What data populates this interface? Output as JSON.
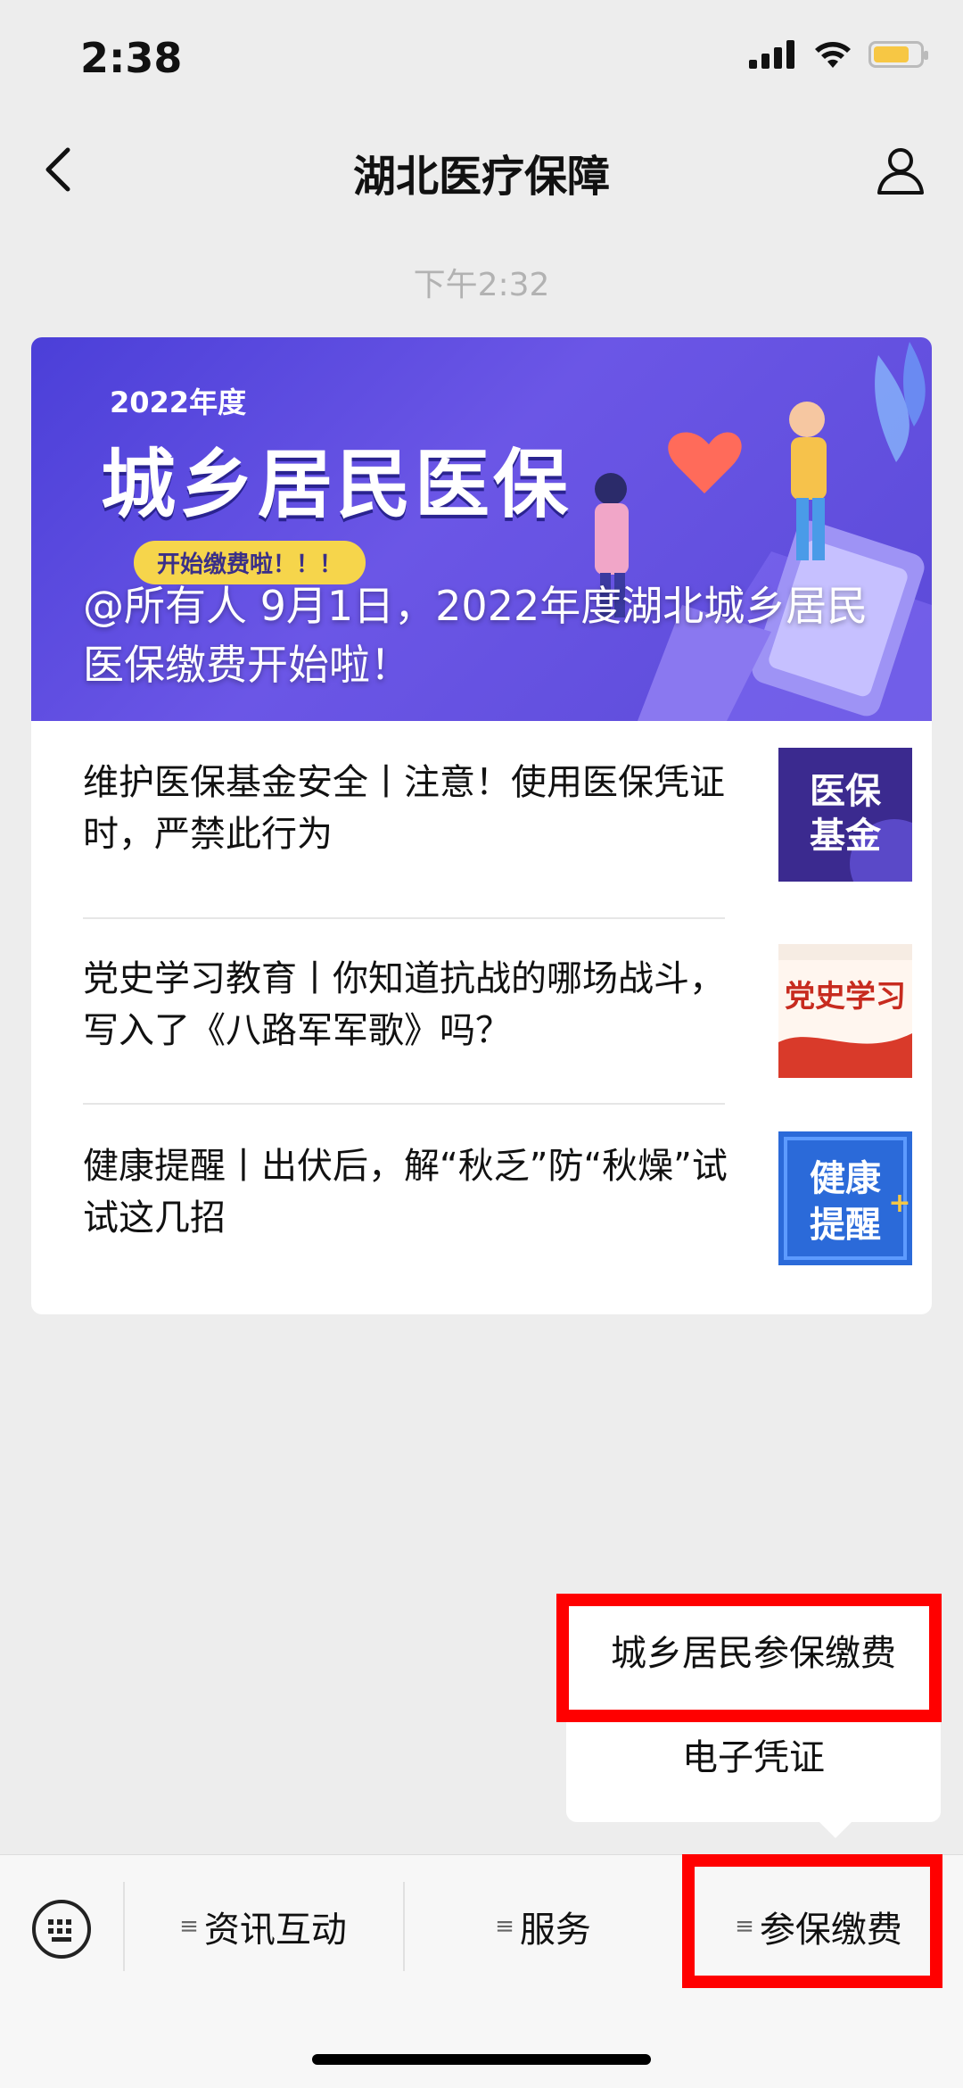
{
  "status_bar": {
    "time": "2:38"
  },
  "nav": {
    "title": "湖北医疗保障"
  },
  "message": {
    "timestamp": "下午2:32"
  },
  "banner": {
    "year_label": "2022年度",
    "main_title": "城乡居民医保",
    "sub_label": "开始缴费啦！！！",
    "overlay_title": "@所有人 9月1日，2022年度湖北城乡居民医保缴费开始啦！"
  },
  "articles": [
    {
      "title": "维护医保基金安全丨注意！使用医保凭证时，严禁此行为",
      "thumb_text": "医保基金"
    },
    {
      "title": "党史学习教育丨你知道抗战的哪场战斗，写入了《八路军军歌》吗？",
      "thumb_text": "党史学习"
    },
    {
      "title": "健康提醒丨出伏后，解“秋乏”防“秋燥”试试这几招",
      "thumb_text": "健康提醒"
    }
  ],
  "popup_menu": {
    "items": [
      "城乡居民参保缴费",
      "电子凭证"
    ]
  },
  "bottom_tabs": [
    {
      "label": "资讯互动"
    },
    {
      "label": "服务"
    },
    {
      "label": "参保缴费"
    }
  ],
  "colors": {
    "highlight": "#ff0000",
    "banner": "#5b4ad8",
    "background": "#ededed"
  }
}
